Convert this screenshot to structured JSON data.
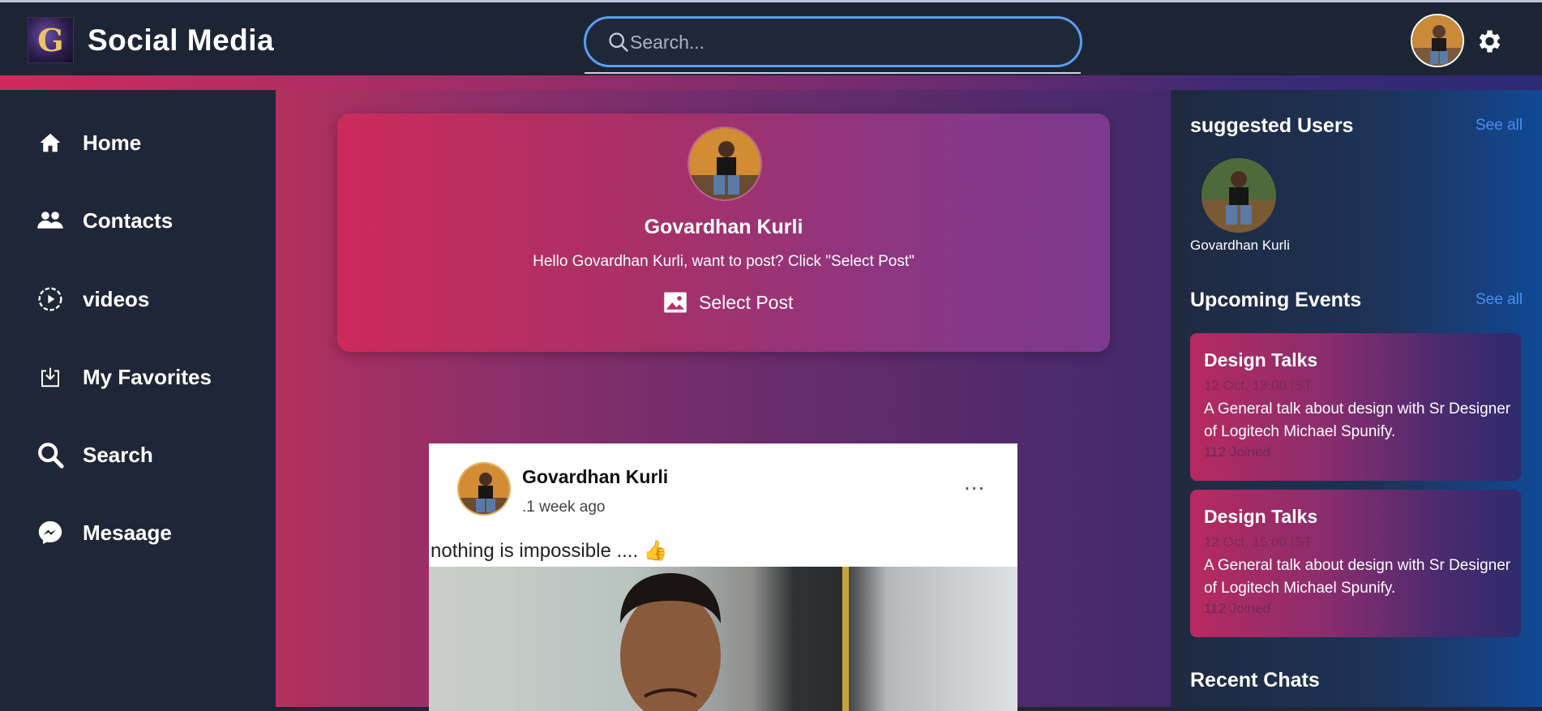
{
  "header": {
    "logo_letter": "G",
    "app_title": "Social Media",
    "search_placeholder": "Search..."
  },
  "sidebar": {
    "items": [
      {
        "label": "Home",
        "icon": "home-icon"
      },
      {
        "label": "Contacts",
        "icon": "contacts-icon"
      },
      {
        "label": "videos",
        "icon": "video-icon"
      },
      {
        "label": "My Favorites",
        "icon": "download-icon"
      },
      {
        "label": "Search",
        "icon": "search-icon"
      },
      {
        "label": "Mesaage",
        "icon": "messenger-icon"
      }
    ]
  },
  "create_post": {
    "name": "Govardhan Kurli",
    "message": "Hello Govardhan Kurli, want to post? Click \"Select Post\"",
    "select_label": "Select Post"
  },
  "post": {
    "author": "Govardhan Kurli",
    "time": ".1 week ago",
    "menu": "...",
    "text": "nothing is impossible .... 👍"
  },
  "right": {
    "suggested_title": "suggested Users",
    "see_all": "See all",
    "suggested_users": [
      {
        "name": "Govardhan Kurli"
      }
    ],
    "events_title": "Upcoming Events",
    "events": [
      {
        "title": "Design Talks",
        "date": "12 Oct, 13:00 IST",
        "description": "A General talk about design with Sr Designer of Logitech Michael Spunify.",
        "joined": "112 Joined"
      },
      {
        "title": "Design Talks",
        "date": "12 Oct, 15:00 IST",
        "description": "A General talk about design with Sr Designer of Logitech Michael Spunify.",
        "joined": "112 Joined"
      }
    ],
    "recent_chats_title": "Recent Chats"
  },
  "colors": {
    "accent": "#5b9ef0",
    "link": "#4a8ef2",
    "sidebar_bg": "#1f2637"
  }
}
